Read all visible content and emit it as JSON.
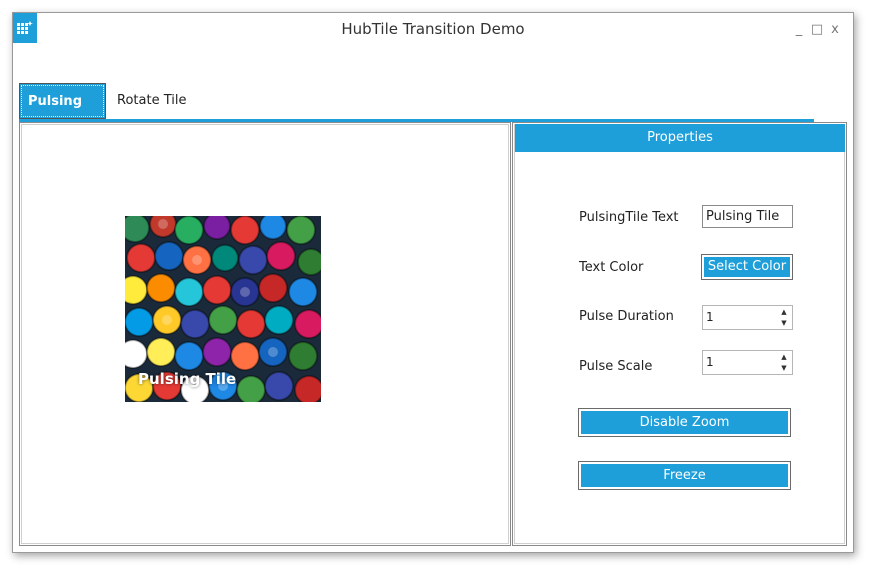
{
  "window": {
    "title": "HubTile Transition Demo",
    "icon": "grid-app-icon",
    "controls": {
      "minimize": "_",
      "maximize": "□",
      "close": "x"
    }
  },
  "tabs": [
    {
      "label": "Pulsing Tile",
      "selected": true
    },
    {
      "label": "Rotate Tile",
      "selected": false
    }
  ],
  "tile": {
    "text": "Pulsing Tile",
    "image": "colorful bottle caps photo"
  },
  "properties": {
    "header": "Properties",
    "pulsing_text_label": "PulsingTile Text",
    "pulsing_text_value": "Pulsing Tile",
    "text_color_label": "Text Color",
    "select_color_button": "Select Color",
    "pulse_duration_label": "Pulse Duration",
    "pulse_duration_value": "1",
    "pulse_scale_label": "Pulse Scale",
    "pulse_scale_value": "1",
    "disable_zoom_button": "Disable Zoom",
    "freeze_button": "Freeze"
  },
  "colors": {
    "accent": "#1e9fda",
    "border": "#8a8a8a",
    "text": "#222222"
  }
}
